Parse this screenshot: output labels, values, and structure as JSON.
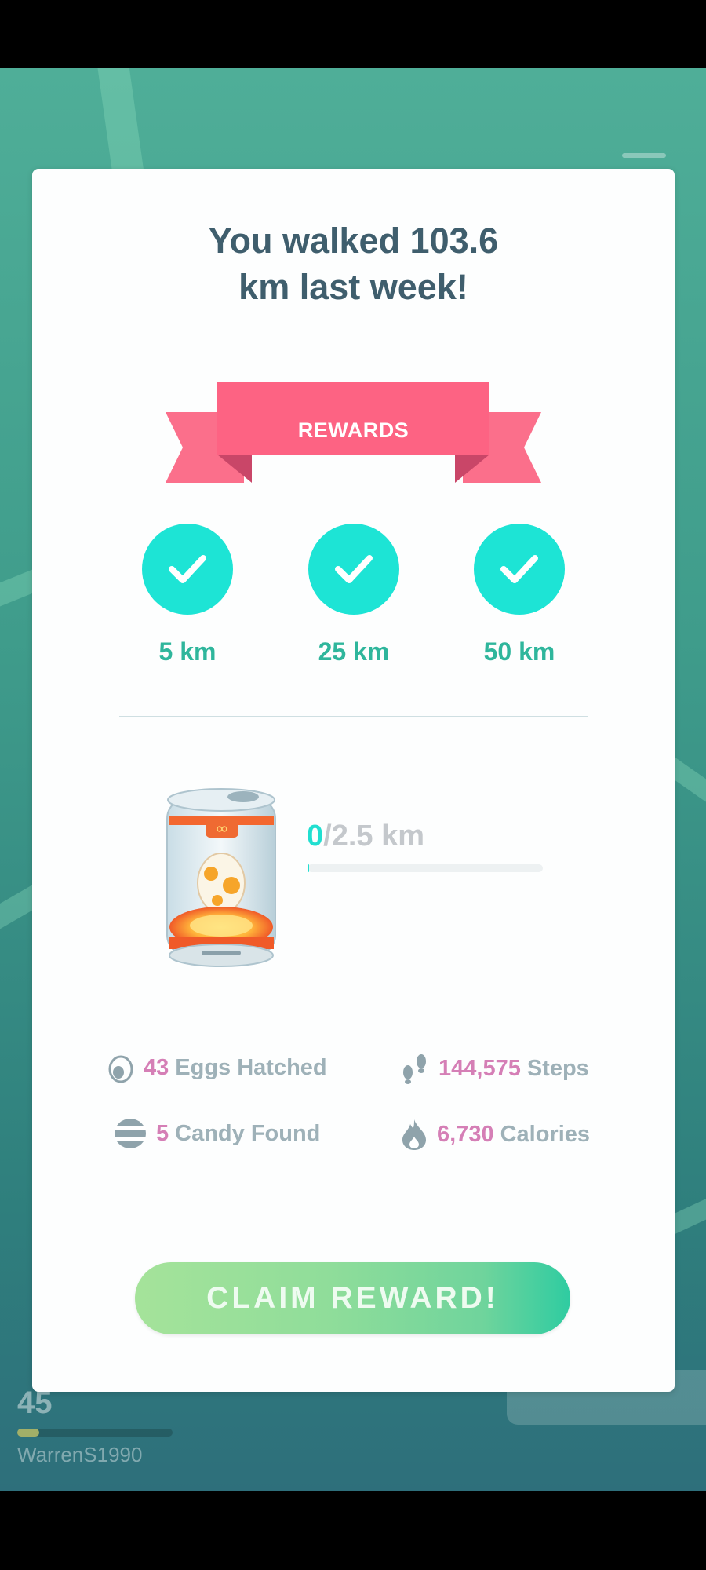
{
  "background": {
    "trainer_level": "45",
    "trainer_name": "WarrenS1990"
  },
  "modal": {
    "title_line1": "You walked 103.6",
    "title_line2": "km last week!",
    "ribbon_label": "REWARDS",
    "milestones": [
      {
        "label": "5 km",
        "completed": true
      },
      {
        "label": "25 km",
        "completed": true
      },
      {
        "label": "50 km",
        "completed": true
      }
    ],
    "incubator": {
      "progress_current": "0",
      "progress_total": "/2.5 km",
      "progress_fraction": 0.005
    },
    "stats": {
      "eggs": {
        "value": "43",
        "label": "Eggs Hatched",
        "icon": "egg-icon"
      },
      "steps": {
        "value": "144,575",
        "label": "Steps",
        "icon": "footprints-icon"
      },
      "candy": {
        "value": "5",
        "label": "Candy Found",
        "icon": "candy-icon"
      },
      "calories": {
        "value": "6,730",
        "label": "Calories",
        "icon": "flame-icon"
      }
    },
    "claim_button": "CLAIM REWARD!"
  },
  "colors": {
    "title": "#3f5e6d",
    "ribbon": "#fd6383",
    "check_circle": "#1de4d5",
    "milestone_text": "#2fb69c",
    "stat_value": "#d57fb6",
    "stat_label": "#9eb1b8",
    "button_start": "#a5e39a",
    "button_end": "#2fcca1"
  }
}
